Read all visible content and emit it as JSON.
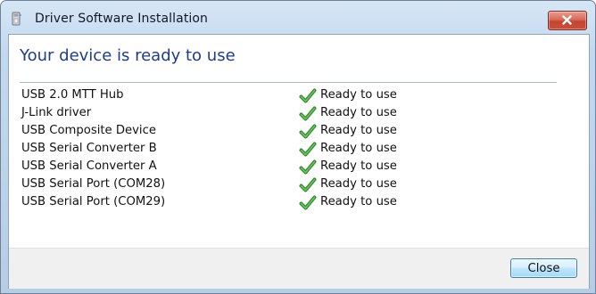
{
  "window": {
    "title": "Driver Software Installation"
  },
  "heading": "Your device is ready to use",
  "devices": [
    {
      "name": "USB 2.0 MTT Hub",
      "status": "Ready to use"
    },
    {
      "name": "J-Link driver",
      "status": "Ready to use"
    },
    {
      "name": "USB Composite Device",
      "status": "Ready to use"
    },
    {
      "name": "USB Serial Converter B",
      "status": "Ready to use"
    },
    {
      "name": "USB Serial Converter A",
      "status": "Ready to use"
    },
    {
      "name": "USB Serial Port (COM28)",
      "status": "Ready to use"
    },
    {
      "name": "USB Serial Port (COM29)",
      "status": "Ready to use"
    }
  ],
  "footer": {
    "close_label": "Close"
  },
  "icons": {
    "app": "device-installer-icon",
    "titlebar_close": "close-icon",
    "status": "checkmark-icon"
  },
  "colors": {
    "heading": "#1f3c8c",
    "check": "#3c9a3a",
    "titlebar_close": "#c44531"
  }
}
